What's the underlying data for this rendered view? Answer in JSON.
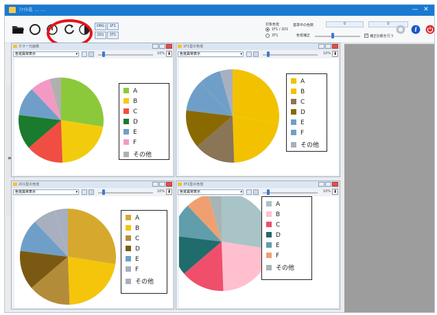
{
  "window": {
    "title": "ﾌｧｲﾙ名  ...  ...",
    "buttons": [
      "—",
      "✕"
    ]
  },
  "toolbar": {
    "icons": [
      "folder-open-icon",
      "circle-outline-icon",
      "rotate-left-icon",
      "rotate-right-icon",
      "half-circle-icon"
    ],
    "seg_buttons": [
      "ORG",
      "1F1",
      "2D1",
      "3T1"
    ],
    "target_label": "対象色覚",
    "radio_options": [
      "1F1 / 2D1",
      "3T1"
    ],
    "base_label": "基準中の色数",
    "input_value_1": "0",
    "input_value_2": "0",
    "diff_label": "色覚補正",
    "checkbox_label": "補正比較を行う",
    "right_icons": [
      "settings-icon",
      "info-icon",
      "power-icon"
    ],
    "colors": {
      "info": "#1a56c9",
      "power": "#d62828"
    }
  },
  "side_expand": "»",
  "panels": [
    {
      "title": "カラー元画像",
      "select": "色覚異常表示",
      "percent": "10%",
      "legend": [
        "A",
        "B",
        "C",
        "D",
        "E",
        "F",
        "その他"
      ],
      "colors": [
        "#8bc93a",
        "#f2cc0c",
        "#f04e43",
        "#1a7a2d",
        "#6f9fc8",
        "#f29ac4",
        "#b0b0b0"
      ],
      "chart_data": {
        "type": "pie",
        "categories": [
          "A",
          "B",
          "C",
          "D",
          "E",
          "F",
          "その他"
        ],
        "values": [
          25,
          20,
          13,
          12,
          10,
          7,
          4
        ]
      }
    },
    {
      "title": "1F1型の色覚",
      "select": "色覚異常表示",
      "percent": "10%",
      "legend": [
        "A",
        "B",
        "C",
        "D",
        "E",
        "F",
        "その他"
      ],
      "colors": [
        "#f2c200",
        "#f2c200",
        "#8a7556",
        "#8a6a00",
        "#6f9fc8",
        "#6f9fc8",
        "#a8b0bf"
      ],
      "chart_data": {
        "type": "pie",
        "categories": [
          "A",
          "B",
          "C",
          "D",
          "E",
          "F",
          "その他"
        ],
        "values": [
          25,
          20,
          13,
          12,
          10,
          7,
          4
        ]
      }
    },
    {
      "title": "2D1型の色覚",
      "select": "色覚異常表示",
      "percent": "10%",
      "legend": [
        "A",
        "B",
        "C",
        "D",
        "E",
        "F",
        "その他"
      ],
      "colors": [
        "#d6a92e",
        "#f4c50a",
        "#b38c3a",
        "#7a5a13",
        "#6f9fc8",
        "#a8b0bf",
        "#a8b0bf"
      ],
      "chart_data": {
        "type": "pie",
        "categories": [
          "A",
          "B",
          "C",
          "D",
          "E",
          "F",
          "その他"
        ],
        "values": [
          25,
          20,
          13,
          12,
          10,
          7,
          4
        ]
      }
    },
    {
      "title": "3T1型の色覚",
      "select": "色覚異常表示",
      "percent": "10%",
      "legend": [
        "A",
        "B",
        "C",
        "D",
        "E",
        "F",
        "その他"
      ],
      "colors": [
        "#a9c4c6",
        "#ffbfcf",
        "#ef4f6b",
        "#206b6b",
        "#5f9eaa",
        "#f0a070",
        "#a8b4b6"
      ],
      "chart_data": {
        "type": "pie",
        "categories": [
          "A",
          "B",
          "C",
          "D",
          "E",
          "F",
          "その他"
        ],
        "values": [
          25,
          20,
          13,
          12,
          10,
          7,
          4
        ]
      }
    }
  ]
}
